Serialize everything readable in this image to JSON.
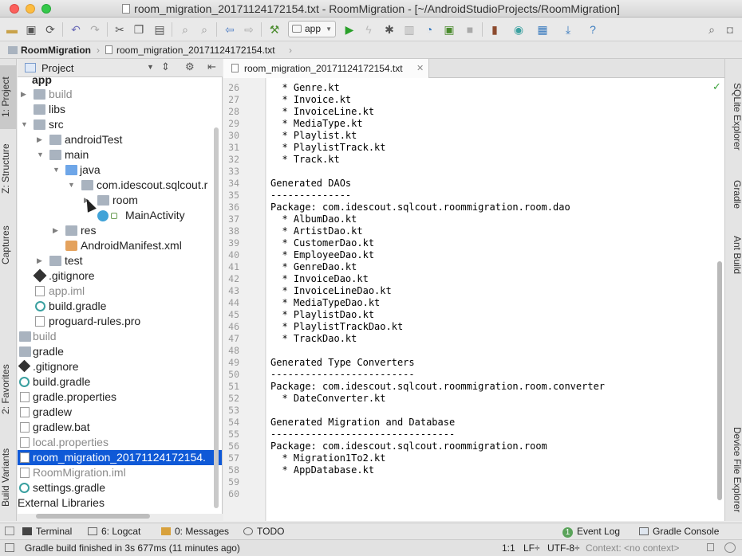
{
  "window": {
    "title": "room_migration_20171124172154.txt - RoomMigration - [~/AndroidStudioProjects/RoomMigration]"
  },
  "toolbar": {
    "run_config": "app"
  },
  "breadcrumb": {
    "project": "RoomMigration",
    "file": "room_migration_20171124172154.txt"
  },
  "left_tabs": {
    "project": "1: Project",
    "structure": "Z: Structure",
    "captures": "Captures",
    "favorites": "2: Favorites",
    "build_variants": "Build Variants"
  },
  "right_tabs": {
    "sqlite": "SQLite Explorer",
    "gradle": "Gradle",
    "ant": "Ant Build",
    "device": "Device File Explorer"
  },
  "project_panel": {
    "title": "Project"
  },
  "tree": [
    {
      "label": "app"
    },
    {
      "label": "build"
    },
    {
      "label": "libs"
    },
    {
      "label": "src"
    },
    {
      "label": "androidTest"
    },
    {
      "label": "main"
    },
    {
      "label": "java"
    },
    {
      "label": "com.idescout.sqlcout.r"
    },
    {
      "label": "room"
    },
    {
      "label": "MainActivity"
    },
    {
      "label": "res"
    },
    {
      "label": "AndroidManifest.xml"
    },
    {
      "label": "test"
    },
    {
      "label": ".gitignore"
    },
    {
      "label": "app.iml"
    },
    {
      "label": "build.gradle"
    },
    {
      "label": "proguard-rules.pro"
    },
    {
      "label": "build"
    },
    {
      "label": "gradle"
    },
    {
      "label": ".gitignore"
    },
    {
      "label": "build.gradle"
    },
    {
      "label": "gradle.properties"
    },
    {
      "label": "gradlew"
    },
    {
      "label": "gradlew.bat"
    },
    {
      "label": "local.properties"
    },
    {
      "label": "room_migration_20171124172154."
    },
    {
      "label": "RoomMigration.iml"
    },
    {
      "label": "settings.gradle"
    },
    {
      "label": "External Libraries"
    }
  ],
  "editor": {
    "tab_label": "room_migration_20171124172154.txt",
    "lines": [
      {
        "n": "26",
        "text": "  * Genre.kt"
      },
      {
        "n": "27",
        "text": "  * Invoice.kt"
      },
      {
        "n": "28",
        "text": "  * InvoiceLine.kt"
      },
      {
        "n": "29",
        "text": "  * MediaType.kt"
      },
      {
        "n": "30",
        "text": "  * Playlist.kt"
      },
      {
        "n": "31",
        "text": "  * PlaylistTrack.kt"
      },
      {
        "n": "32",
        "text": "  * Track.kt"
      },
      {
        "n": "33",
        "text": ""
      },
      {
        "n": "34",
        "text": "Generated DAOs"
      },
      {
        "n": "35",
        "text": "--------------"
      },
      {
        "n": "36",
        "text": "Package: com.idescout.sqlcout.roommigration.room.dao"
      },
      {
        "n": "37",
        "text": "  * AlbumDao.kt"
      },
      {
        "n": "38",
        "text": "  * ArtistDao.kt"
      },
      {
        "n": "39",
        "text": "  * CustomerDao.kt"
      },
      {
        "n": "40",
        "text": "  * EmployeeDao.kt"
      },
      {
        "n": "41",
        "text": "  * GenreDao.kt"
      },
      {
        "n": "42",
        "text": "  * InvoiceDao.kt"
      },
      {
        "n": "43",
        "text": "  * InvoiceLineDao.kt"
      },
      {
        "n": "44",
        "text": "  * MediaTypeDao.kt"
      },
      {
        "n": "45",
        "text": "  * PlaylistDao.kt"
      },
      {
        "n": "46",
        "text": "  * PlaylistTrackDao.kt"
      },
      {
        "n": "47",
        "text": "  * TrackDao.kt"
      },
      {
        "n": "48",
        "text": ""
      },
      {
        "n": "49",
        "text": "Generated Type Converters"
      },
      {
        "n": "50",
        "text": "-------------------------"
      },
      {
        "n": "51",
        "text": "Package: com.idescout.sqlcout.roommigration.room.converter"
      },
      {
        "n": "52",
        "text": "  * DateConverter.kt"
      },
      {
        "n": "53",
        "text": ""
      },
      {
        "n": "54",
        "text": "Generated Migration and Database"
      },
      {
        "n": "55",
        "text": "--------------------------------"
      },
      {
        "n": "56",
        "text": "Package: com.idescout.sqlcout.roommigration.room"
      },
      {
        "n": "57",
        "text": "  * Migration1To2.kt"
      },
      {
        "n": "58",
        "text": "  * AppDatabase.kt"
      },
      {
        "n": "59",
        "text": ""
      },
      {
        "n": "60",
        "text": ""
      }
    ]
  },
  "bottom_tabs": {
    "terminal": "Terminal",
    "logcat": "6: Logcat",
    "messages": "0: Messages",
    "todo": "TODO",
    "event_log_badge": "1",
    "event_log": "Event Log",
    "gradle_console": "Gradle Console"
  },
  "status": {
    "message": "Gradle build finished in 3s 677ms (11 minutes ago)",
    "position": "1:1",
    "line_sep": "LF÷",
    "encoding": "UTF-8÷",
    "context": "Context: <no context>"
  }
}
